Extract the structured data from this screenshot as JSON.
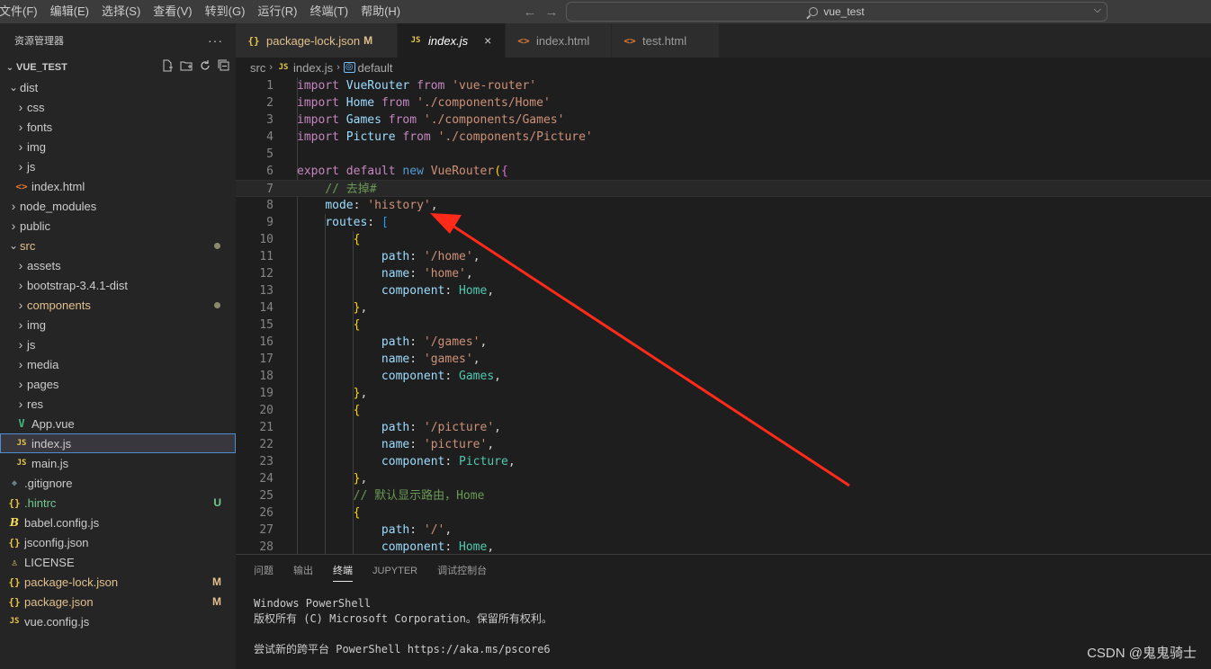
{
  "menu": [
    "文件(F)",
    "编辑(E)",
    "选择(S)",
    "查看(V)",
    "转到(G)",
    "运行(R)",
    "终端(T)",
    "帮助(H)"
  ],
  "nav": {
    "back": "←",
    "forward": "→"
  },
  "command_center": {
    "text": "vue_test"
  },
  "explorer": {
    "title": "资源管理器",
    "more": "···",
    "project": "VUE_TEST",
    "tree": [
      {
        "label": "dist",
        "depth": 0,
        "kind": "folder",
        "open": true
      },
      {
        "label": "css",
        "depth": 1,
        "kind": "folder",
        "open": false
      },
      {
        "label": "fonts",
        "depth": 1,
        "kind": "folder",
        "open": false
      },
      {
        "label": "img",
        "depth": 1,
        "kind": "folder",
        "open": false
      },
      {
        "label": "js",
        "depth": 1,
        "kind": "folder",
        "open": false
      },
      {
        "label": "index.html",
        "depth": 1,
        "kind": "html"
      },
      {
        "label": "node_modules",
        "depth": 0,
        "kind": "folder",
        "open": false
      },
      {
        "label": "public",
        "depth": 0,
        "kind": "folder",
        "open": false
      },
      {
        "label": "src",
        "depth": 0,
        "kind": "folder",
        "open": true,
        "state": "mod",
        "dot": true
      },
      {
        "label": "assets",
        "depth": 1,
        "kind": "folder",
        "open": false
      },
      {
        "label": "bootstrap-3.4.1-dist",
        "depth": 1,
        "kind": "folder",
        "open": false
      },
      {
        "label": "components",
        "depth": 1,
        "kind": "folder",
        "open": false,
        "state": "mod",
        "dot": true
      },
      {
        "label": "img",
        "depth": 1,
        "kind": "folder",
        "open": false
      },
      {
        "label": "js",
        "depth": 1,
        "kind": "folder",
        "open": false
      },
      {
        "label": "media",
        "depth": 1,
        "kind": "folder",
        "open": false
      },
      {
        "label": "pages",
        "depth": 1,
        "kind": "folder",
        "open": false
      },
      {
        "label": "res",
        "depth": 1,
        "kind": "folder",
        "open": false
      },
      {
        "label": "App.vue",
        "depth": 1,
        "kind": "vue"
      },
      {
        "label": "index.js",
        "depth": 1,
        "kind": "js",
        "selected": true
      },
      {
        "label": "main.js",
        "depth": 1,
        "kind": "js"
      },
      {
        "label": ".gitignore",
        "depth": 0,
        "kind": "git"
      },
      {
        "label": ".hintrc",
        "depth": 0,
        "kind": "json",
        "state": "untracked",
        "badge": "U"
      },
      {
        "label": "babel.config.js",
        "depth": 0,
        "kind": "babel"
      },
      {
        "label": "jsconfig.json",
        "depth": 0,
        "kind": "json"
      },
      {
        "label": "LICENSE",
        "depth": 0,
        "kind": "lic"
      },
      {
        "label": "package-lock.json",
        "depth": 0,
        "kind": "json",
        "state": "mod",
        "badge": "M"
      },
      {
        "label": "package.json",
        "depth": 0,
        "kind": "json",
        "state": "mod",
        "badge": "M"
      },
      {
        "label": "vue.config.js",
        "depth": 0,
        "kind": "js"
      }
    ]
  },
  "tabs": [
    {
      "label": "package-lock.json",
      "kind": "json",
      "flag": "M",
      "state": "mod"
    },
    {
      "label": "index.js",
      "kind": "js",
      "active": true,
      "close": "×"
    },
    {
      "label": "index.html",
      "kind": "html"
    },
    {
      "label": "test.html",
      "kind": "html"
    }
  ],
  "breadcrumb": {
    "folder": "src",
    "file": "index.js",
    "symbol": "default"
  },
  "code": {
    "current_line": 7,
    "lines": [
      [
        [
          "kw",
          "import"
        ],
        [
          "pl",
          " "
        ],
        [
          "id",
          "VueRouter"
        ],
        [
          "pl",
          " "
        ],
        [
          "kw",
          "from"
        ],
        [
          "pl",
          " "
        ],
        [
          "str",
          "'vue-router'"
        ]
      ],
      [
        [
          "kw",
          "import"
        ],
        [
          "pl",
          " "
        ],
        [
          "id",
          "Home"
        ],
        [
          "pl",
          " "
        ],
        [
          "kw",
          "from"
        ],
        [
          "pl",
          " "
        ],
        [
          "str",
          "'./components/Home'"
        ]
      ],
      [
        [
          "kw",
          "import"
        ],
        [
          "pl",
          " "
        ],
        [
          "id",
          "Games"
        ],
        [
          "pl",
          " "
        ],
        [
          "kw",
          "from"
        ],
        [
          "pl",
          " "
        ],
        [
          "str",
          "'./components/Games'"
        ]
      ],
      [
        [
          "kw",
          "import"
        ],
        [
          "pl",
          " "
        ],
        [
          "id",
          "Picture"
        ],
        [
          "pl",
          " "
        ],
        [
          "kw",
          "from"
        ],
        [
          "pl",
          " "
        ],
        [
          "str",
          "'./components/Picture'"
        ]
      ],
      [],
      [
        [
          "kw",
          "export"
        ],
        [
          "pl",
          " "
        ],
        [
          "kw",
          "default"
        ],
        [
          "pl",
          " "
        ],
        [
          "kw2",
          "new"
        ],
        [
          "pl",
          " "
        ],
        [
          "str",
          "VueRouter"
        ],
        [
          "p1",
          "("
        ],
        [
          "p2",
          "{"
        ]
      ],
      [
        [
          "pl",
          "    "
        ],
        [
          "cmt",
          "// 去掉#"
        ]
      ],
      [
        [
          "pl",
          "    "
        ],
        [
          "id",
          "mode"
        ],
        [
          "pl",
          ": "
        ],
        [
          "str",
          "'history'"
        ],
        [
          "pl",
          ","
        ]
      ],
      [
        [
          "pl",
          "    "
        ],
        [
          "id",
          "routes"
        ],
        [
          "pl",
          ": "
        ],
        [
          "p3",
          "["
        ]
      ],
      [
        [
          "pl",
          "        "
        ],
        [
          "p1",
          "{"
        ]
      ],
      [
        [
          "pl",
          "            "
        ],
        [
          "id",
          "path"
        ],
        [
          "pl",
          ": "
        ],
        [
          "str",
          "'/home'"
        ],
        [
          "pl",
          ","
        ]
      ],
      [
        [
          "pl",
          "            "
        ],
        [
          "id",
          "name"
        ],
        [
          "pl",
          ": "
        ],
        [
          "str",
          "'home'"
        ],
        [
          "pl",
          ","
        ]
      ],
      [
        [
          "pl",
          "            "
        ],
        [
          "id",
          "component"
        ],
        [
          "pl",
          ": "
        ],
        [
          "cls",
          "Home"
        ],
        [
          "pl",
          ","
        ]
      ],
      [
        [
          "pl",
          "        "
        ],
        [
          "p1",
          "}"
        ],
        [
          "pl",
          ","
        ]
      ],
      [
        [
          "pl",
          "        "
        ],
        [
          "p1",
          "{"
        ]
      ],
      [
        [
          "pl",
          "            "
        ],
        [
          "id",
          "path"
        ],
        [
          "pl",
          ": "
        ],
        [
          "str",
          "'/games'"
        ],
        [
          "pl",
          ","
        ]
      ],
      [
        [
          "pl",
          "            "
        ],
        [
          "id",
          "name"
        ],
        [
          "pl",
          ": "
        ],
        [
          "str",
          "'games'"
        ],
        [
          "pl",
          ","
        ]
      ],
      [
        [
          "pl",
          "            "
        ],
        [
          "id",
          "component"
        ],
        [
          "pl",
          ": "
        ],
        [
          "cls",
          "Games"
        ],
        [
          "pl",
          ","
        ]
      ],
      [
        [
          "pl",
          "        "
        ],
        [
          "p1",
          "}"
        ],
        [
          "pl",
          ","
        ]
      ],
      [
        [
          "pl",
          "        "
        ],
        [
          "p1",
          "{"
        ]
      ],
      [
        [
          "pl",
          "            "
        ],
        [
          "id",
          "path"
        ],
        [
          "pl",
          ": "
        ],
        [
          "str",
          "'/picture'"
        ],
        [
          "pl",
          ","
        ]
      ],
      [
        [
          "pl",
          "            "
        ],
        [
          "id",
          "name"
        ],
        [
          "pl",
          ": "
        ],
        [
          "str",
          "'picture'"
        ],
        [
          "pl",
          ","
        ]
      ],
      [
        [
          "pl",
          "            "
        ],
        [
          "id",
          "component"
        ],
        [
          "pl",
          ": "
        ],
        [
          "cls",
          "Picture"
        ],
        [
          "pl",
          ","
        ]
      ],
      [
        [
          "pl",
          "        "
        ],
        [
          "p1",
          "}"
        ],
        [
          "pl",
          ","
        ]
      ],
      [
        [
          "pl",
          "        "
        ],
        [
          "cmt",
          "// 默认显示路由，Home"
        ]
      ],
      [
        [
          "pl",
          "        "
        ],
        [
          "p1",
          "{"
        ]
      ],
      [
        [
          "pl",
          "            "
        ],
        [
          "id",
          "path"
        ],
        [
          "pl",
          ": "
        ],
        [
          "str",
          "'/'"
        ],
        [
          "pl",
          ","
        ]
      ],
      [
        [
          "pl",
          "            "
        ],
        [
          "id",
          "component"
        ],
        [
          "pl",
          ": "
        ],
        [
          "cls",
          "Home"
        ],
        [
          "pl",
          ","
        ]
      ]
    ]
  },
  "panel": {
    "tabs": [
      "问题",
      "输出",
      "终端",
      "JUPYTER",
      "调试控制台"
    ],
    "active_tab": "终端",
    "terminal": [
      "Windows PowerShell",
      "版权所有 (C) Microsoft Corporation。保留所有权利。",
      "",
      "尝试新的跨平台 PowerShell https://aka.ms/pscore6"
    ]
  },
  "watermark": "CSDN @鬼鬼骑士",
  "colors": {
    "annotation_arrow": "#ff2a1a",
    "accent_selection": "#4f8cd6",
    "modified": "#e2c08d",
    "untracked": "#73c991"
  }
}
